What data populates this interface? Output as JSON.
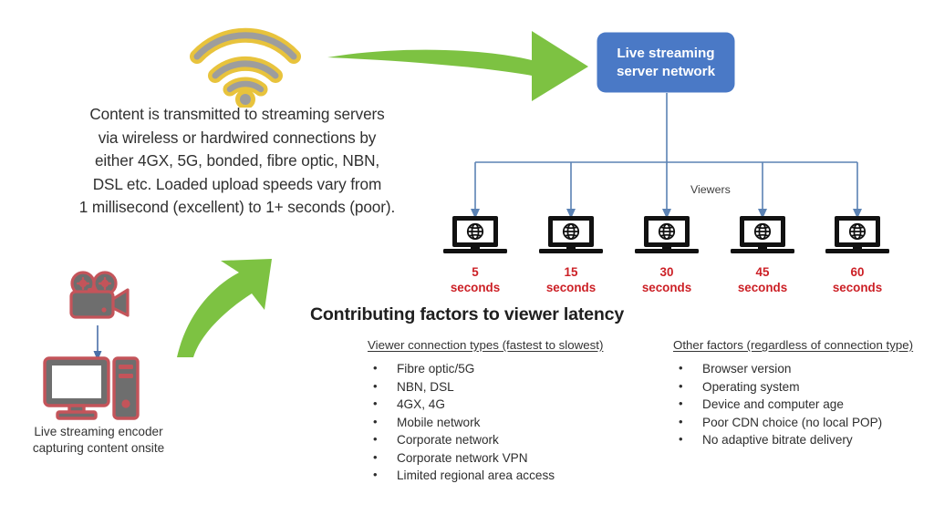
{
  "diagram": {
    "intro_text": "Content is transmitted to streaming servers\nvia wireless or hardwired connections by\neither 4GX, 5G, bonded, fibre optic, NBN,\nDSL etc. Loaded upload speeds vary from\n1 millisecond (excellent) to 1+ seconds (poor).",
    "server_box_label": "Live streaming\nserver network",
    "viewers_label": "Viewers",
    "encoder_caption": "Live streaming encoder\ncapturing content onsite",
    "factors_heading": "Contributing factors to viewer latency"
  },
  "clients": [
    {
      "value": "5",
      "unit": "seconds",
      "icon": "laptop-globe-icon"
    },
    {
      "value": "15",
      "unit": "seconds",
      "icon": "laptop-globe-icon"
    },
    {
      "value": "30",
      "unit": "seconds",
      "icon": "laptop-globe-icon"
    },
    {
      "value": "45",
      "unit": "seconds",
      "icon": "laptop-globe-icon"
    },
    {
      "value": "60",
      "unit": "seconds",
      "icon": "laptop-globe-icon"
    }
  ],
  "connection_types": {
    "title": "Viewer connection types (fastest to slowest)",
    "items": [
      "Fibre optic/5G",
      "NBN, DSL",
      "4GX, 4G",
      "Mobile network",
      "Corporate network",
      "Corporate network VPN",
      "Limited regional area access"
    ]
  },
  "other_factors": {
    "title": "Other factors (regardless of connection type)",
    "items": [
      "Browser version",
      "Operating system",
      "Device and computer age",
      "Poor CDN choice (no local POP)",
      "No adaptive bitrate delivery"
    ]
  },
  "icons": {
    "wifi": "wifi-signal-icon",
    "arrow_right": "green-curved-arrow-right-icon",
    "arrow_up": "green-curved-arrow-up-icon",
    "camera": "video-camera-icon",
    "computer": "desktop-computer-icon",
    "connector_arrow": "connector-arrow-icon"
  },
  "colors": {
    "server_blue": "#4a79c6",
    "arrow_green": "#7dc242",
    "wifi_gold": "#e8c33c",
    "wifi_gray": "#9a9a9a",
    "latency_red": "#cc2026",
    "device_red": "#c4545a",
    "device_gray": "#6e6e6e",
    "connector_blue": "#5b82b4",
    "text_dark": "#303030"
  }
}
